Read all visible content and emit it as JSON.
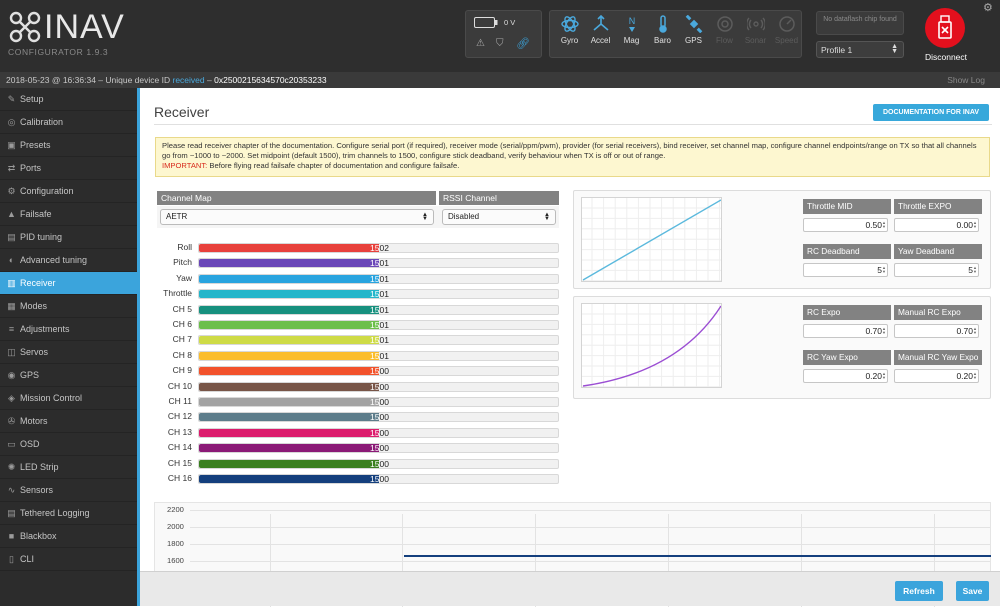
{
  "app": {
    "logo_text": "INAV",
    "subtitle": "CONFIGURATOR  1.9.3",
    "battery": "0 V",
    "dataflash_text": "No dataflash chip found",
    "profile": "Profile 1",
    "disconnect": "Disconnect"
  },
  "sensors": [
    {
      "label": "Gyro",
      "icon": "gyro-icon",
      "active": true
    },
    {
      "label": "Accel",
      "icon": "accel-icon",
      "active": true
    },
    {
      "label": "Mag",
      "icon": "mag-icon",
      "active": true
    },
    {
      "label": "Baro",
      "icon": "baro-icon",
      "active": true
    },
    {
      "label": "GPS",
      "icon": "gps-icon",
      "active": true
    },
    {
      "label": "Flow",
      "icon": "flow-icon",
      "active": false
    },
    {
      "label": "Sonar",
      "icon": "sonar-icon",
      "active": false
    },
    {
      "label": "Speed",
      "icon": "speed-icon",
      "active": false
    }
  ],
  "status": {
    "prefix": "2018-05-23 @ 16:36:34 – Unique device ID",
    "received": "received",
    "sep": "–",
    "device_id": "0x2500215634570c20353233",
    "show_log": "Show Log"
  },
  "nav": [
    {
      "label": "Setup",
      "icon": "wrench-icon",
      "glyph": "✎",
      "active": false
    },
    {
      "label": "Calibration",
      "icon": "calibration-icon",
      "glyph": "◎",
      "active": false
    },
    {
      "label": "Presets",
      "icon": "presets-icon",
      "glyph": "▣",
      "active": false
    },
    {
      "label": "Ports",
      "icon": "ports-icon",
      "glyph": "⇄",
      "active": false
    },
    {
      "label": "Configuration",
      "icon": "gear-icon",
      "glyph": "⚙",
      "active": false
    },
    {
      "label": "Failsafe",
      "icon": "failsafe-icon",
      "glyph": "▲",
      "active": false
    },
    {
      "label": "PID tuning",
      "icon": "pid-icon",
      "glyph": "▤",
      "active": false
    },
    {
      "label": "Advanced tuning",
      "icon": "advanced-tuning-icon",
      "glyph": "◐",
      "active": false
    },
    {
      "label": "Receiver",
      "icon": "receiver-icon",
      "glyph": "▥",
      "active": true
    },
    {
      "label": "Modes",
      "icon": "modes-icon",
      "glyph": "▦",
      "active": false
    },
    {
      "label": "Adjustments",
      "icon": "adjustments-icon",
      "glyph": "≡",
      "active": false
    },
    {
      "label": "Servos",
      "icon": "servos-icon",
      "glyph": "◫",
      "active": false
    },
    {
      "label": "GPS",
      "icon": "gps-nav-icon",
      "glyph": "◉",
      "active": false
    },
    {
      "label": "Mission Control",
      "icon": "mission-icon",
      "glyph": "◈",
      "active": false
    },
    {
      "label": "Motors",
      "icon": "motors-icon",
      "glyph": "✇",
      "active": false
    },
    {
      "label": "OSD",
      "icon": "osd-icon",
      "glyph": "▭",
      "active": false
    },
    {
      "label": "LED Strip",
      "icon": "led-icon",
      "glyph": "✺",
      "active": false
    },
    {
      "label": "Sensors",
      "icon": "sensors-icon",
      "glyph": "∿",
      "active": false
    },
    {
      "label": "Tethered Logging",
      "icon": "logging-icon",
      "glyph": "▤",
      "active": false
    },
    {
      "label": "Blackbox",
      "icon": "blackbox-icon",
      "glyph": "■",
      "active": false
    },
    {
      "label": "CLI",
      "icon": "cli-icon",
      "glyph": "▯",
      "active": false
    }
  ],
  "page": {
    "title": "Receiver",
    "doc_button": "DOCUMENTATION FOR INAV",
    "note_text": "Please read receiver chapter of the documentation. Configure serial port (if required), receiver mode (serial/ppm/pwm), provider (for serial receivers), bind receiver, set channel map, configure channel endpoints/range on TX so that all channels go from ~1000 to ~2000. Set midpoint (default 1500), trim channels to 1500, configure stick deadband, verify behaviour when TX is off or out of range.",
    "note_important": "IMPORTANT:",
    "note_important_text": " Before flying read failsafe chapter of documentation and configure failsafe.",
    "channel_map_label": "Channel Map",
    "channel_map_value": "AETR",
    "rssi_label": "RSSI Channel",
    "rssi_value": "Disabled"
  },
  "channels": [
    {
      "name": "Roll",
      "value": "1502",
      "level": 0.501,
      "color": "#e8413c"
    },
    {
      "name": "Pitch",
      "value": "1501",
      "level": 0.5005,
      "color": "#6a47b8"
    },
    {
      "name": "Yaw",
      "value": "1501",
      "level": 0.5005,
      "color": "#29a4df"
    },
    {
      "name": "Throttle",
      "value": "1501",
      "level": 0.5005,
      "color": "#24b6ca"
    },
    {
      "name": "CH 5",
      "value": "1501",
      "level": 0.5005,
      "color": "#16907e"
    },
    {
      "name": "CH 6",
      "value": "1501",
      "level": 0.5005,
      "color": "#6cbf4b"
    },
    {
      "name": "CH 7",
      "value": "1501",
      "level": 0.5005,
      "color": "#cedb46"
    },
    {
      "name": "CH 8",
      "value": "1501",
      "level": 0.5005,
      "color": "#fbbd2c"
    },
    {
      "name": "CH 9",
      "value": "1500",
      "level": 0.5,
      "color": "#f2522b"
    },
    {
      "name": "CH 10",
      "value": "1500",
      "level": 0.5,
      "color": "#785547"
    },
    {
      "name": "CH 11",
      "value": "1500",
      "level": 0.5,
      "color": "#a3a3a3"
    },
    {
      "name": "CH 12",
      "value": "1500",
      "level": 0.5,
      "color": "#5d7d8b"
    },
    {
      "name": "CH 13",
      "value": "1500",
      "level": 0.5,
      "color": "#dc1c6d"
    },
    {
      "name": "CH 14",
      "value": "1500",
      "level": 0.5,
      "color": "#8b1a77"
    },
    {
      "name": "CH 15",
      "value": "1500",
      "level": 0.5,
      "color": "#3a7f1f"
    },
    {
      "name": "CH 16",
      "value": "1500",
      "level": 0.5,
      "color": "#143f7d"
    }
  ],
  "throttle_panel": {
    "mid_label": "Throttle MID",
    "mid_value": "0.50",
    "expo_label": "Throttle EXPO",
    "expo_value": "0.00",
    "deadband_label": "RC Deadband",
    "deadband_value": "5",
    "yaw_deadband_label": "Yaw Deadband",
    "yaw_deadband_value": "5",
    "curve_color": "#5bb9dd"
  },
  "rate_panel": {
    "rc_expo_label": "RC Expo",
    "rc_expo_value": "0.70",
    "manual_expo_label": "Manual RC Expo",
    "manual_expo_value": "0.70",
    "rc_yaw_expo_label": "RC Yaw Expo",
    "rc_yaw_expo_value": "0.20",
    "manual_yaw_expo_label": "Manual RC Yaw Expo",
    "manual_yaw_expo_value": "0.20",
    "curve_color": "#9b4ed3"
  },
  "plot": {
    "y_ticks": [
      "2200",
      "2000",
      "1800",
      "1600"
    ],
    "line_color": "#143f7d"
  },
  "footer": {
    "refresh": "Refresh",
    "save": "Save"
  }
}
